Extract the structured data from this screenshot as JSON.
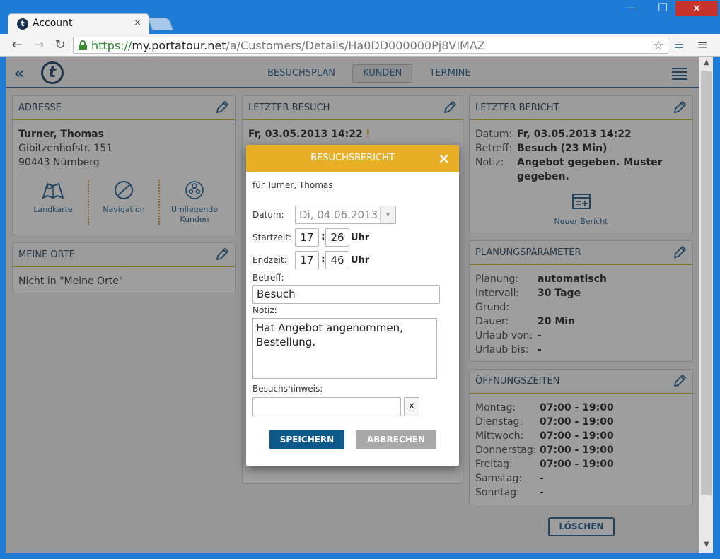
{
  "browser": {
    "tab_title": "Account",
    "tab_close": "×",
    "url_scheme": "https://",
    "url_host": "my.portatour.net",
    "url_path": "/a/Customers/Details/Ha0DD000000Pj8VIMAZ",
    "window_min": "—",
    "window_max": "☐",
    "window_close": "✕"
  },
  "app": {
    "nav": {
      "visits": "BESUCHSPLAN",
      "customers": "KUNDEN",
      "appointments": "TERMINE"
    }
  },
  "address": {
    "title": "ADRESSE",
    "name": "Turner, Thomas",
    "street": "Gibitzenhofstr. 151",
    "city": "90443 Nürnberg",
    "actions": {
      "map": "Landkarte",
      "navigation": "Navigation",
      "nearby_line1": "Umliegende",
      "nearby_line2": "Kunden"
    }
  },
  "places": {
    "title": "MEINE ORTE",
    "text": "Nicht in \"Meine Orte\""
  },
  "last_visit": {
    "title": "LETZTER BESUCH",
    "date": "Fr, 03.05.2013 14:22",
    "flag": "!"
  },
  "last_report": {
    "title": "LETZTER BERICHT",
    "date_label": "Datum:",
    "date_value": "Fr, 03.05.2013 14:22",
    "subject_label": "Betreff:",
    "subject_value": "Besuch (23 Min)",
    "note_label": "Notiz:",
    "note_value_line1": "Angebot gegeben. Muster",
    "note_value_line2": "gegeben.",
    "new_report": "Neuer Bericht"
  },
  "planning": {
    "title": "PLANUNGSPARAMETER",
    "rows": [
      {
        "label": "Planung:",
        "value": "automatisch"
      },
      {
        "label": "Intervall:",
        "value": "30 Tage"
      },
      {
        "label": "Grund:",
        "value": ""
      },
      {
        "label": "Dauer:",
        "value": "20 Min"
      },
      {
        "label": "Urlaub von:",
        "value": "-"
      },
      {
        "label": "Urlaub bis:",
        "value": "-"
      }
    ]
  },
  "hours": {
    "title": "ÖFFNUNGSZEITEN",
    "rows": [
      {
        "day": "Montag:",
        "time": "07:00 - 19:00"
      },
      {
        "day": "Dienstag:",
        "time": "07:00 - 19:00"
      },
      {
        "day": "Mittwoch:",
        "time": "07:00 - 19:00"
      },
      {
        "day": "Donnerstag:",
        "time": "07:00 - 19:00"
      },
      {
        "day": "Freitag:",
        "time": "07:00 - 19:00"
      },
      {
        "day": "Samstag:",
        "time": "-"
      },
      {
        "day": "Sonntag:",
        "time": "-"
      }
    ]
  },
  "delete_button": "LÖSCHEN",
  "dialog": {
    "title": "BESUCHSBERICHT",
    "close": "×",
    "subtitle": "für Turner, Thomas",
    "date_label": "Datum:",
    "date_value": "Di, 04.06.2013",
    "start_label": "Startzeit:",
    "start_hour": "17",
    "start_min": "26",
    "end_label": "Endzeit:",
    "end_hour": "17",
    "end_min": "46",
    "colon": ":",
    "unit": "Uhr",
    "subject_label": "Betreff:",
    "subject_value": "Besuch",
    "note_label": "Notiz:",
    "note_line1": "Hat Angebot angenommen,",
    "note_line2": "Bestellung.",
    "hint_label": "Besuchshinweis:",
    "hint_value": "",
    "hint_clear": "x",
    "save": "SPEICHERN",
    "cancel": "ABBRECHEN"
  }
}
